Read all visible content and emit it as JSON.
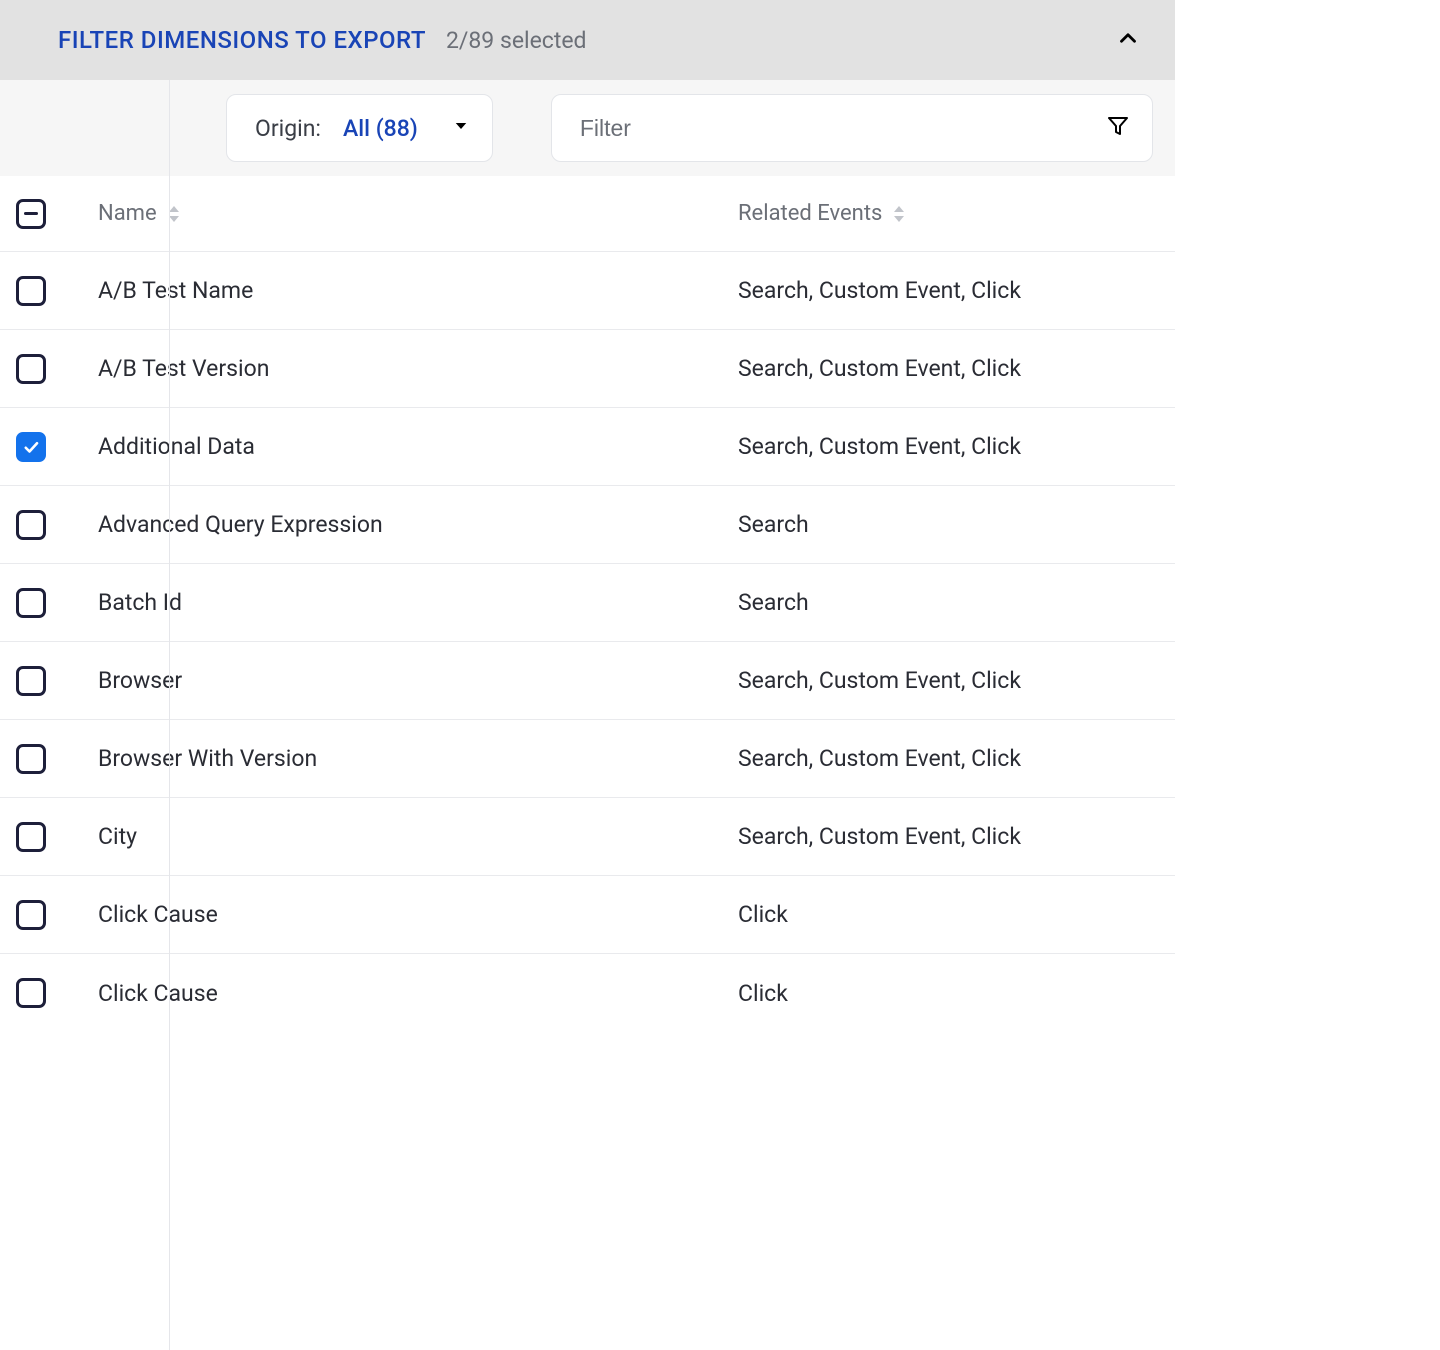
{
  "banner": {
    "title": "FILTER DIMENSIONS TO EXPORT",
    "selected_text": "2/89 selected"
  },
  "origin": {
    "label": "Origin:",
    "value": "All (88)"
  },
  "filter": {
    "placeholder": "Filter"
  },
  "columns": {
    "name": "Name",
    "events": "Related Events"
  },
  "select_all_state": "indeterminate",
  "rows": [
    {
      "checked": false,
      "name": "A/B Test Name",
      "events": "Search, Custom Event, Click"
    },
    {
      "checked": false,
      "name": "A/B Test Version",
      "events": "Search, Custom Event, Click"
    },
    {
      "checked": true,
      "name": "Additional Data",
      "events": "Search, Custom Event, Click"
    },
    {
      "checked": false,
      "name": "Advanced Query Expression",
      "events": "Search"
    },
    {
      "checked": false,
      "name": "Batch Id",
      "events": "Search"
    },
    {
      "checked": false,
      "name": "Browser",
      "events": "Search, Custom Event, Click"
    },
    {
      "checked": false,
      "name": "Browser With Version",
      "events": "Search, Custom Event, Click"
    },
    {
      "checked": false,
      "name": "City",
      "events": "Search, Custom Event, Click"
    },
    {
      "checked": false,
      "name": "Click Cause",
      "events": "Click"
    },
    {
      "checked": false,
      "name": "Click Cause",
      "events": "Click"
    }
  ]
}
